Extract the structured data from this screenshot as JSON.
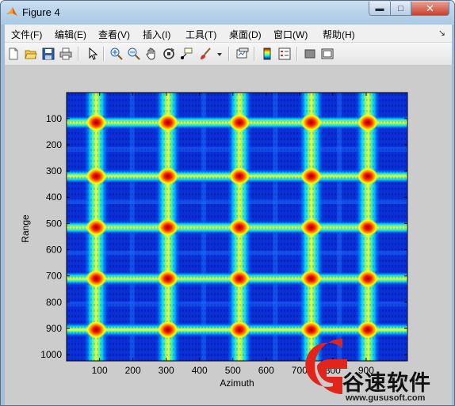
{
  "window": {
    "title": "Figure 4",
    "icon": "matlab-logo-icon"
  },
  "menu": [
    "文件(F)",
    "编辑(E)",
    "查看(V)",
    "插入(I)",
    "工具(T)",
    "桌面(D)",
    "窗口(W)",
    "帮助(H)"
  ],
  "toolbar": {
    "icons": [
      "new-figure-icon",
      "open-file-icon",
      "save-icon",
      "print-icon",
      "edit-plot-arrow-icon",
      "zoom-in-icon",
      "zoom-out-icon",
      "pan-hand-icon",
      "rotate-3d-icon",
      "data-cursor-icon",
      "brush-icon",
      "link-plot-icon",
      "colorbar-icon",
      "legend-icon",
      "hide-plot-tools-icon",
      "show-plot-tools-icon"
    ]
  },
  "axes": {
    "xlabel": "Azimuth",
    "ylabel": "Range",
    "xticks": [
      "100",
      "200",
      "300",
      "400",
      "500",
      "600",
      "700",
      "800",
      "900"
    ],
    "yticks": [
      "100",
      "200",
      "300",
      "400",
      "500",
      "600",
      "700",
      "800",
      "900",
      "1000"
    ]
  },
  "image": {
    "colormap": "jet",
    "x_range": [
      1,
      1024
    ],
    "y_range": [
      1,
      1024
    ],
    "peak_columns_azimuth": [
      90,
      305,
      520,
      735,
      905
    ],
    "peak_rows_range": [
      115,
      320,
      515,
      710,
      905
    ]
  },
  "watermark": {
    "text": "谷速软件",
    "url": "www.gususoft.com",
    "brand_color": "#e1251b"
  },
  "colors": {
    "title_bar": "#b8d1e8",
    "figure_background": "#cccccc",
    "close_button": "#c9402c"
  }
}
